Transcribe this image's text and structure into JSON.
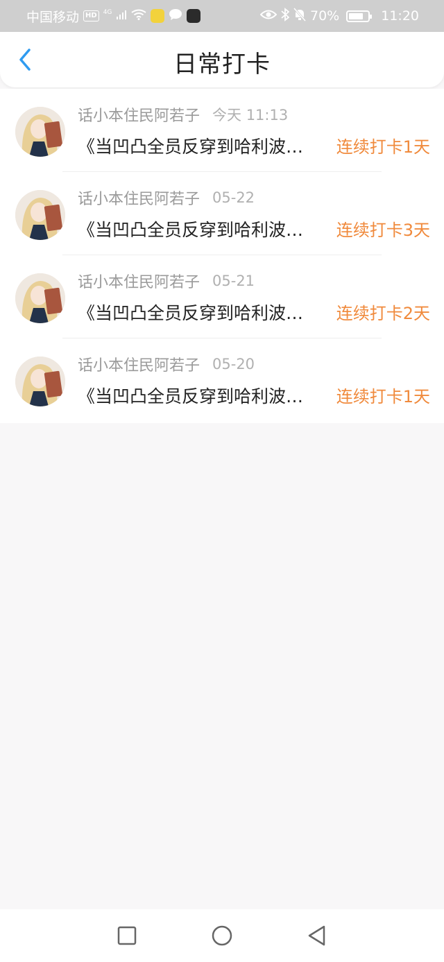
{
  "status_bar": {
    "carrier": "中国移动",
    "hd_badge": "HD",
    "network": "4G",
    "battery": "70%",
    "time": "11:20"
  },
  "header": {
    "title": "日常打卡"
  },
  "checkins": [
    {
      "username": "话小本住民阿若子",
      "date": "今天 11:13",
      "title": "《当凹凸全员反穿到哈利波…",
      "streak": "连续打卡1天"
    },
    {
      "username": "话小本住民阿若子",
      "date": "05-22",
      "title": "《当凹凸全员反穿到哈利波…",
      "streak": "连续打卡3天"
    },
    {
      "username": "话小本住民阿若子",
      "date": "05-21",
      "title": "《当凹凸全员反穿到哈利波…",
      "streak": "连续打卡2天"
    },
    {
      "username": "话小本住民阿若子",
      "date": "05-20",
      "title": "《当凹凸全员反穿到哈利波…",
      "streak": "连续打卡1天"
    }
  ],
  "icons": {
    "back": "chevron-left-icon",
    "nav_square": "recent-apps-icon",
    "nav_circle": "home-icon",
    "nav_triangle": "back-icon"
  },
  "colors": {
    "accent_blue": "#2f9bf0",
    "streak_orange": "#f08a3c",
    "status_bar_bg": "#cfcfcf",
    "page_bg": "#f8f7f8"
  }
}
